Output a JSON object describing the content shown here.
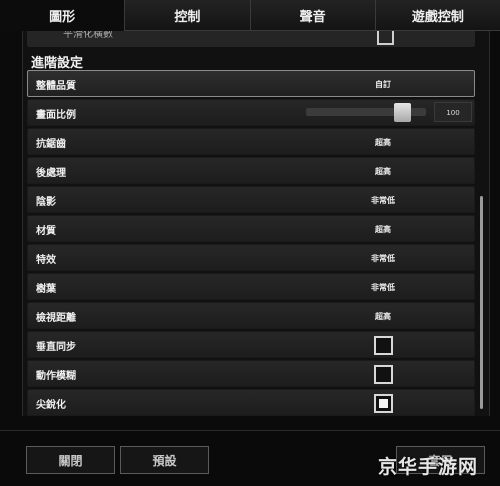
{
  "tabs": [
    {
      "label": "圖形",
      "active": true
    },
    {
      "label": "控制",
      "active": false
    },
    {
      "label": "聲音",
      "active": false
    },
    {
      "label": "遊戲控制",
      "active": false
    }
  ],
  "clipped_row": {
    "label": "平滑化橫數"
  },
  "section_title": "進階設定",
  "settings": [
    {
      "label": "整體品質",
      "value": "自訂",
      "kind": "value",
      "highlighted": true
    },
    {
      "label": "畫面比例",
      "slider_value": "100",
      "slider_fraction": 0.85,
      "kind": "slider"
    },
    {
      "label": "抗鋸齒",
      "value": "超高",
      "kind": "value"
    },
    {
      "label": "後處理",
      "value": "超高",
      "kind": "value"
    },
    {
      "label": "陰影",
      "value": "非常低",
      "kind": "value"
    },
    {
      "label": "材質",
      "value": "超高",
      "kind": "value"
    },
    {
      "label": "特效",
      "value": "非常低",
      "kind": "value"
    },
    {
      "label": "樹葉",
      "value": "非常低",
      "kind": "value"
    },
    {
      "label": "檢視距離",
      "value": "超高",
      "kind": "value"
    },
    {
      "label": "垂直同步",
      "checked": false,
      "kind": "checkbox"
    },
    {
      "label": "動作模糊",
      "checked": false,
      "kind": "checkbox"
    },
    {
      "label": "尖銳化",
      "checked": true,
      "kind": "checkbox"
    }
  ],
  "buttons": {
    "close": "關閉",
    "default": "預設",
    "apply": "套用"
  },
  "watermark": "京华手游网"
}
